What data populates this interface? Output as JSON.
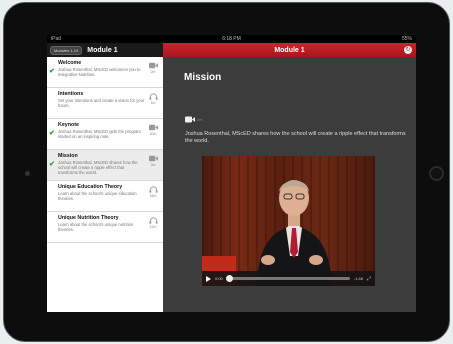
{
  "status": {
    "carrier": "iPad",
    "time": "6:18 PM",
    "battery": "55%"
  },
  "sidebar": {
    "tag": "Modules 1-10",
    "title": "Module 1",
    "items": [
      {
        "title": "Welcome",
        "desc": "Joshua Rosenthal, MScED welcomes you to Integrative Nutrition.",
        "type": "video",
        "duration": "2m",
        "checked": true
      },
      {
        "title": "Intentions",
        "desc": "Set your intentions and create a vision for your future.",
        "type": "audio",
        "duration": "1m",
        "checked": false
      },
      {
        "title": "Keynote",
        "desc": "Joshua Rosenthal, MScED gets the program started on an inspiring note.",
        "type": "video",
        "duration": "20m",
        "checked": true
      },
      {
        "title": "Mission",
        "desc": "Joshua Rosenthal, MScED shares how the school will create a ripple effect that transforms the world.",
        "type": "video",
        "duration": "2m",
        "checked": true
      },
      {
        "title": "Unique Education Theory",
        "desc": "Learn about the school's unique education theories.",
        "type": "audio",
        "duration": "16m",
        "checked": false
      },
      {
        "title": "Unique Nutrition Theory",
        "desc": "Learn about the school's unique nutrition theories.",
        "type": "audio",
        "duration": "12m",
        "checked": false
      }
    ]
  },
  "main": {
    "header": "Module 1",
    "lesson_title": "Mission",
    "duration": "2m",
    "description": "Joshua Rosenthal, MScED shares how the school will create a ripple effect that transforms the world.",
    "player": {
      "elapsed": "0:00",
      "remaining": "-1:46",
      "progress": 0.02
    }
  },
  "colors": {
    "accent": "#b8202a",
    "check": "#2e9a2e"
  }
}
